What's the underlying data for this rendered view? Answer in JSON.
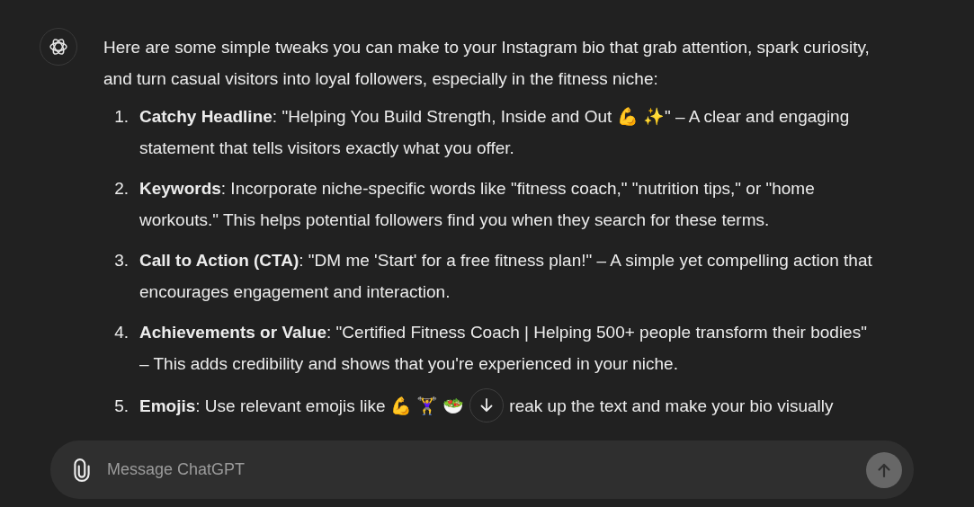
{
  "message": {
    "intro": "Here are some simple tweaks you can make to your Instagram bio that grab attention, spark curiosity, and turn casual visitors into loyal followers, especially in the fitness niche:",
    "items": [
      {
        "number": "1.",
        "text": "**Catchy Headline**: \"Helping You Build Strength, Inside and Out 💪 ✨\" – A clear and engaging statement that tells visitors exactly what you offer."
      },
      {
        "number": "2.",
        "text": "**Keywords**: Incorporate niche-specific words like \"fitness coach,\" \"nutrition tips,\" or \"home workouts.\" This helps potential followers find you when they search for these terms."
      },
      {
        "number": "3.",
        "text": "**Call to Action (CTA)**: \"DM me 'Start' for a free fitness plan!\" – A simple yet compelling action that encourages engagement and interaction."
      },
      {
        "number": "4.",
        "text": "**Achievements or Value**: \"Certified Fitness Coach | Helping 500+ people transform their bodies\" – This adds credibility and shows that you're experienced in your niche."
      },
      {
        "number": "5.",
        "text": "**Emojis**: Use relevant emojis like 💪 🏋️‍♀️ 🥗",
        "text_after": "reak up the text and make your bio visually"
      }
    ]
  },
  "composer": {
    "placeholder": "Message ChatGPT",
    "send_disabled": true
  }
}
